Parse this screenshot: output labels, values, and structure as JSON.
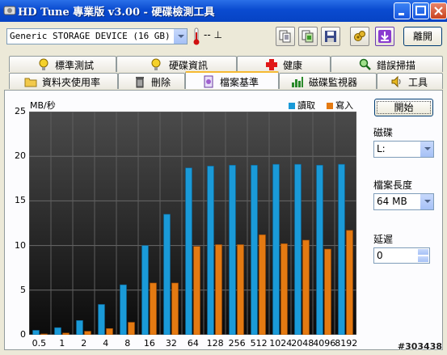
{
  "window": {
    "title": "HD Tune 專業版 v3.00 - 硬碟檢測工具"
  },
  "toolbar": {
    "device": "Generic STORAGE DEVICE (16 GB)",
    "temperature": "-- ⊥",
    "exit_label": "離開",
    "icons": [
      "copy-text-icon",
      "copy-screenshot-icon",
      "save-icon",
      "options-icon",
      "down-arrow-icon"
    ]
  },
  "tabs_top": [
    {
      "label": "標準測試",
      "icon": "info-icon"
    },
    {
      "label": "硬碟資訊",
      "icon": "info-icon"
    },
    {
      "label": "健康",
      "icon": "health-cross-icon"
    },
    {
      "label": "錯誤掃描",
      "icon": "scan-magnifier-icon"
    }
  ],
  "tabs_bottom": [
    {
      "label": "資料夾使用率",
      "icon": "folder-icon"
    },
    {
      "label": "刪除",
      "icon": "trash-icon"
    },
    {
      "label": "檔案基準",
      "icon": "file-benchmark-icon",
      "active": true
    },
    {
      "label": "磁碟監視器",
      "icon": "disk-monitor-icon"
    },
    {
      "label": "工具",
      "icon": "speaker-icon"
    }
  ],
  "side": {
    "start_label": "開始",
    "drive_label": "磁碟",
    "drive_value": "L:",
    "file_length_label": "檔案長度",
    "file_length_value": "64 MB",
    "delay_label": "延遲",
    "delay_value": "0"
  },
  "watermark": "#303438",
  "colors": {
    "read": "#1a9ad8",
    "write": "#e47a12"
  },
  "chart_data": {
    "type": "bar",
    "ylabel": "MB/秒",
    "ylim": [
      0,
      25
    ],
    "yticks": [
      0,
      5,
      10,
      15,
      20,
      25
    ],
    "grid": true,
    "legend_position": "top-right",
    "categories": [
      "0.5",
      "1",
      "2",
      "4",
      "8",
      "16",
      "32",
      "64",
      "128",
      "256",
      "512",
      "1024",
      "2048",
      "4096",
      "8192"
    ],
    "series": [
      {
        "name": "讀取",
        "values": [
          0.5,
          0.8,
          1.6,
          3.4,
          5.6,
          10.0,
          13.5,
          18.7,
          18.9,
          19.0,
          19.0,
          19.1,
          19.1,
          19.0,
          19.1
        ]
      },
      {
        "name": "寫入",
        "values": [
          0.1,
          0.2,
          0.4,
          0.7,
          1.4,
          5.8,
          5.8,
          9.9,
          10.1,
          10.1,
          11.2,
          10.2,
          10.6,
          9.6,
          11.7
        ]
      }
    ]
  }
}
